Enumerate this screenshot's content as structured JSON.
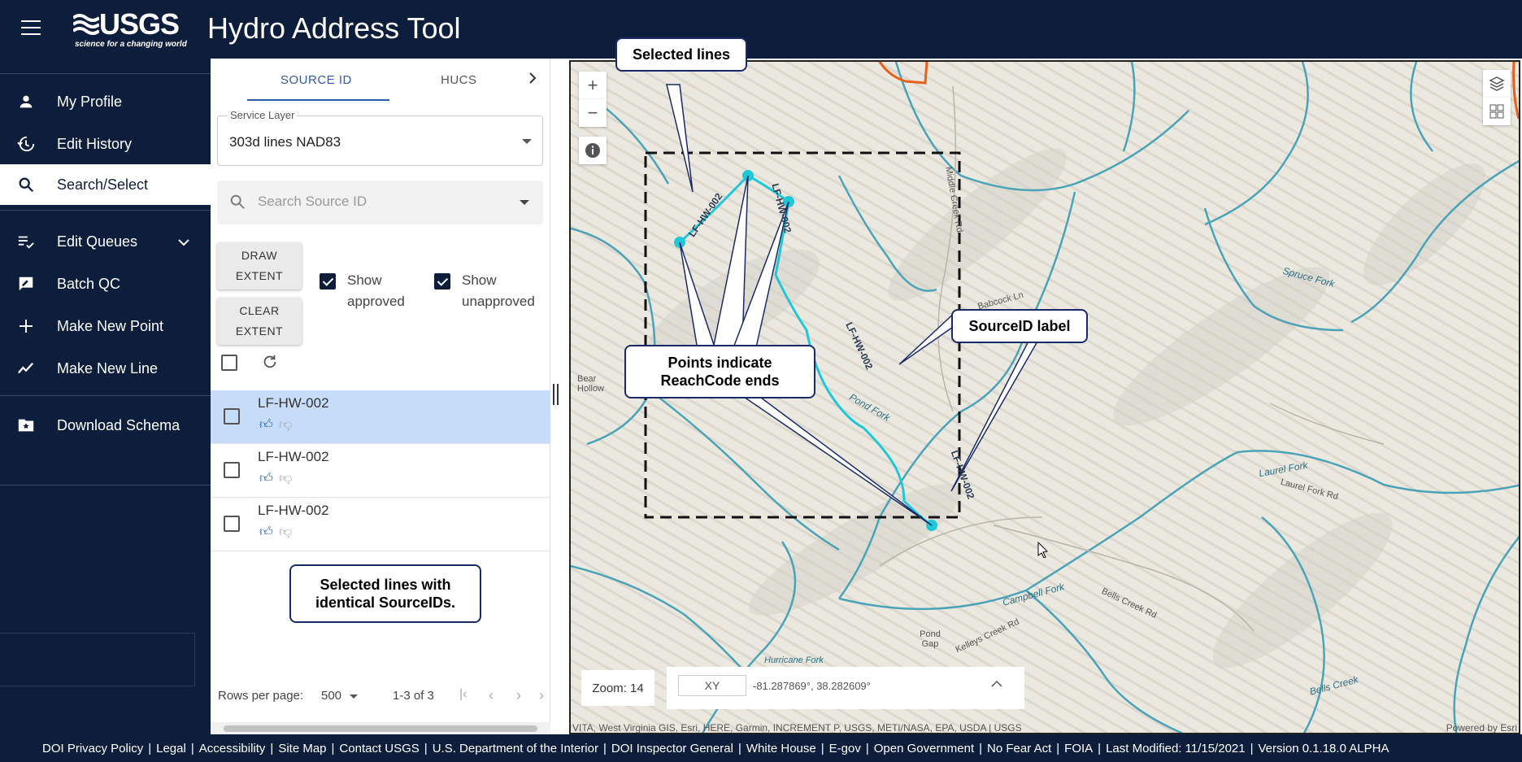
{
  "header": {
    "logo_text": "USGS",
    "logo_tagline": "science for a changing world",
    "app_title": "Hydro Address Tool"
  },
  "sidebar": {
    "items": [
      {
        "label": "My Profile",
        "icon": "person-icon"
      },
      {
        "label": "Edit History",
        "icon": "history-icon"
      },
      {
        "label": "Search/Select",
        "icon": "search-icon"
      },
      {
        "label": "Edit Queues",
        "icon": "playlist-check-icon"
      },
      {
        "label": "Batch QC",
        "icon": "rate-review-icon"
      },
      {
        "label": "Make New Point",
        "icon": "plus-icon"
      },
      {
        "label": "Make New Line",
        "icon": "show-chart-icon"
      },
      {
        "label": "Download Schema",
        "icon": "folder-star-icon"
      }
    ]
  },
  "panel": {
    "tabs": [
      {
        "label": "SOURCE ID"
      },
      {
        "label": "HUCS"
      }
    ],
    "service_layer": {
      "label": "Service Layer",
      "value": "303d lines NAD83"
    },
    "search": {
      "placeholder": "Search Source ID"
    },
    "buttons": {
      "draw_extent_1": "DRAW",
      "draw_extent_2": "EXTENT",
      "clear_extent_1": "CLEAR",
      "clear_extent_2": "EXTENT"
    },
    "checks": {
      "show_approved_1": "Show",
      "show_approved_2": "approved",
      "show_unapproved_1": "Show",
      "show_unapproved_2": "unapproved"
    },
    "rows": [
      {
        "id": "LF-HW-002"
      },
      {
        "id": "LF-HW-002"
      },
      {
        "id": "LF-HW-002"
      }
    ],
    "pager": {
      "rows_label": "Rows per page:",
      "rows_value": "500",
      "range": "1-3 of 3"
    }
  },
  "map": {
    "zoom": "Zoom: 14",
    "xy_label": "XY",
    "coords": "-81.287869°, 38.282609°",
    "attribution": "VITA, West Virginia GIS, Esri, HERE, Garmin, INCREMENT P, USGS, METI/NASA, EPA, USDA | USGS",
    "powered_by": "Powered by Esri",
    "line_labels": [
      "LF-HW-002",
      "LF-HW-002",
      "LF-HW-002",
      "LF-HW-002"
    ],
    "place_labels": [
      "Spruce Fork",
      "Laurel Fork",
      "Laurel Fork Rd",
      "Campbell Fork",
      "Bells Creek",
      "Pond Fork",
      "Pond Gap",
      "Kelleys Creek Rd",
      "Hurricane Fork",
      "Bear Hollow",
      "Babcock Ln",
      "Middle Creek Rd",
      "Bells Creek Rd"
    ],
    "colors": {
      "stream": "#4aa3b8",
      "selected": "#1ec8d8",
      "road": "#e8601c"
    }
  },
  "callouts": {
    "selected_lines": "Selected lines",
    "points_1": "Points indicate",
    "points_2": "ReachCode ends",
    "sourceid": "SourceID label",
    "identical_1": "Selected lines with",
    "identical_2": "identical SourceIDs."
  },
  "footer": {
    "links": [
      "DOI Privacy Policy",
      "Legal",
      "Accessibility",
      "Site Map",
      "Contact USGS",
      "U.S. Department of the Interior",
      "DOI Inspector General",
      "White House",
      "E-gov",
      "Open Government",
      "No Fear Act",
      "FOIA",
      "Last Modified: 11/15/2021",
      "Version 0.1.18.0 ALPHA"
    ]
  }
}
